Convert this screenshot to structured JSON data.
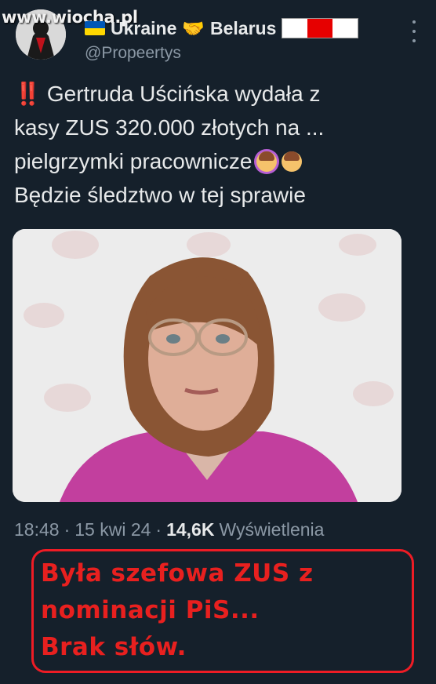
{
  "watermark": "www.wiocha.pl",
  "author": {
    "display_name": "Ukraine",
    "handshake": "🤝",
    "display_name_2": "Belarus",
    "handle": "@Propeertys"
  },
  "tweet": {
    "excl": "‼️",
    "lines": [
      "Gertruda Uścińska wydała z",
      "kasy ZUS 320.000 złotych na ...",
      "pielgrzymki pracownicze",
      "Będzie śledztwo w tej sprawie"
    ]
  },
  "meta": {
    "time": "18:48",
    "date": "15 kwi 24",
    "views_count": "14,6K",
    "views_label": "Wyświetlenia"
  },
  "caption": {
    "lines": [
      "Była szefowa ZUS z",
      "nominacji PiS...",
      "Brak słów."
    ]
  },
  "colors": {
    "background": "#15202b",
    "caption_red": "#e8201f",
    "secondary_text": "#8b98a5"
  },
  "icons": [
    "ukraine-flag-icon",
    "handshake-icon",
    "belarus-flag-icon",
    "more-icon",
    "woman-emoji-icon",
    "facepalm-emoji-icon"
  ]
}
